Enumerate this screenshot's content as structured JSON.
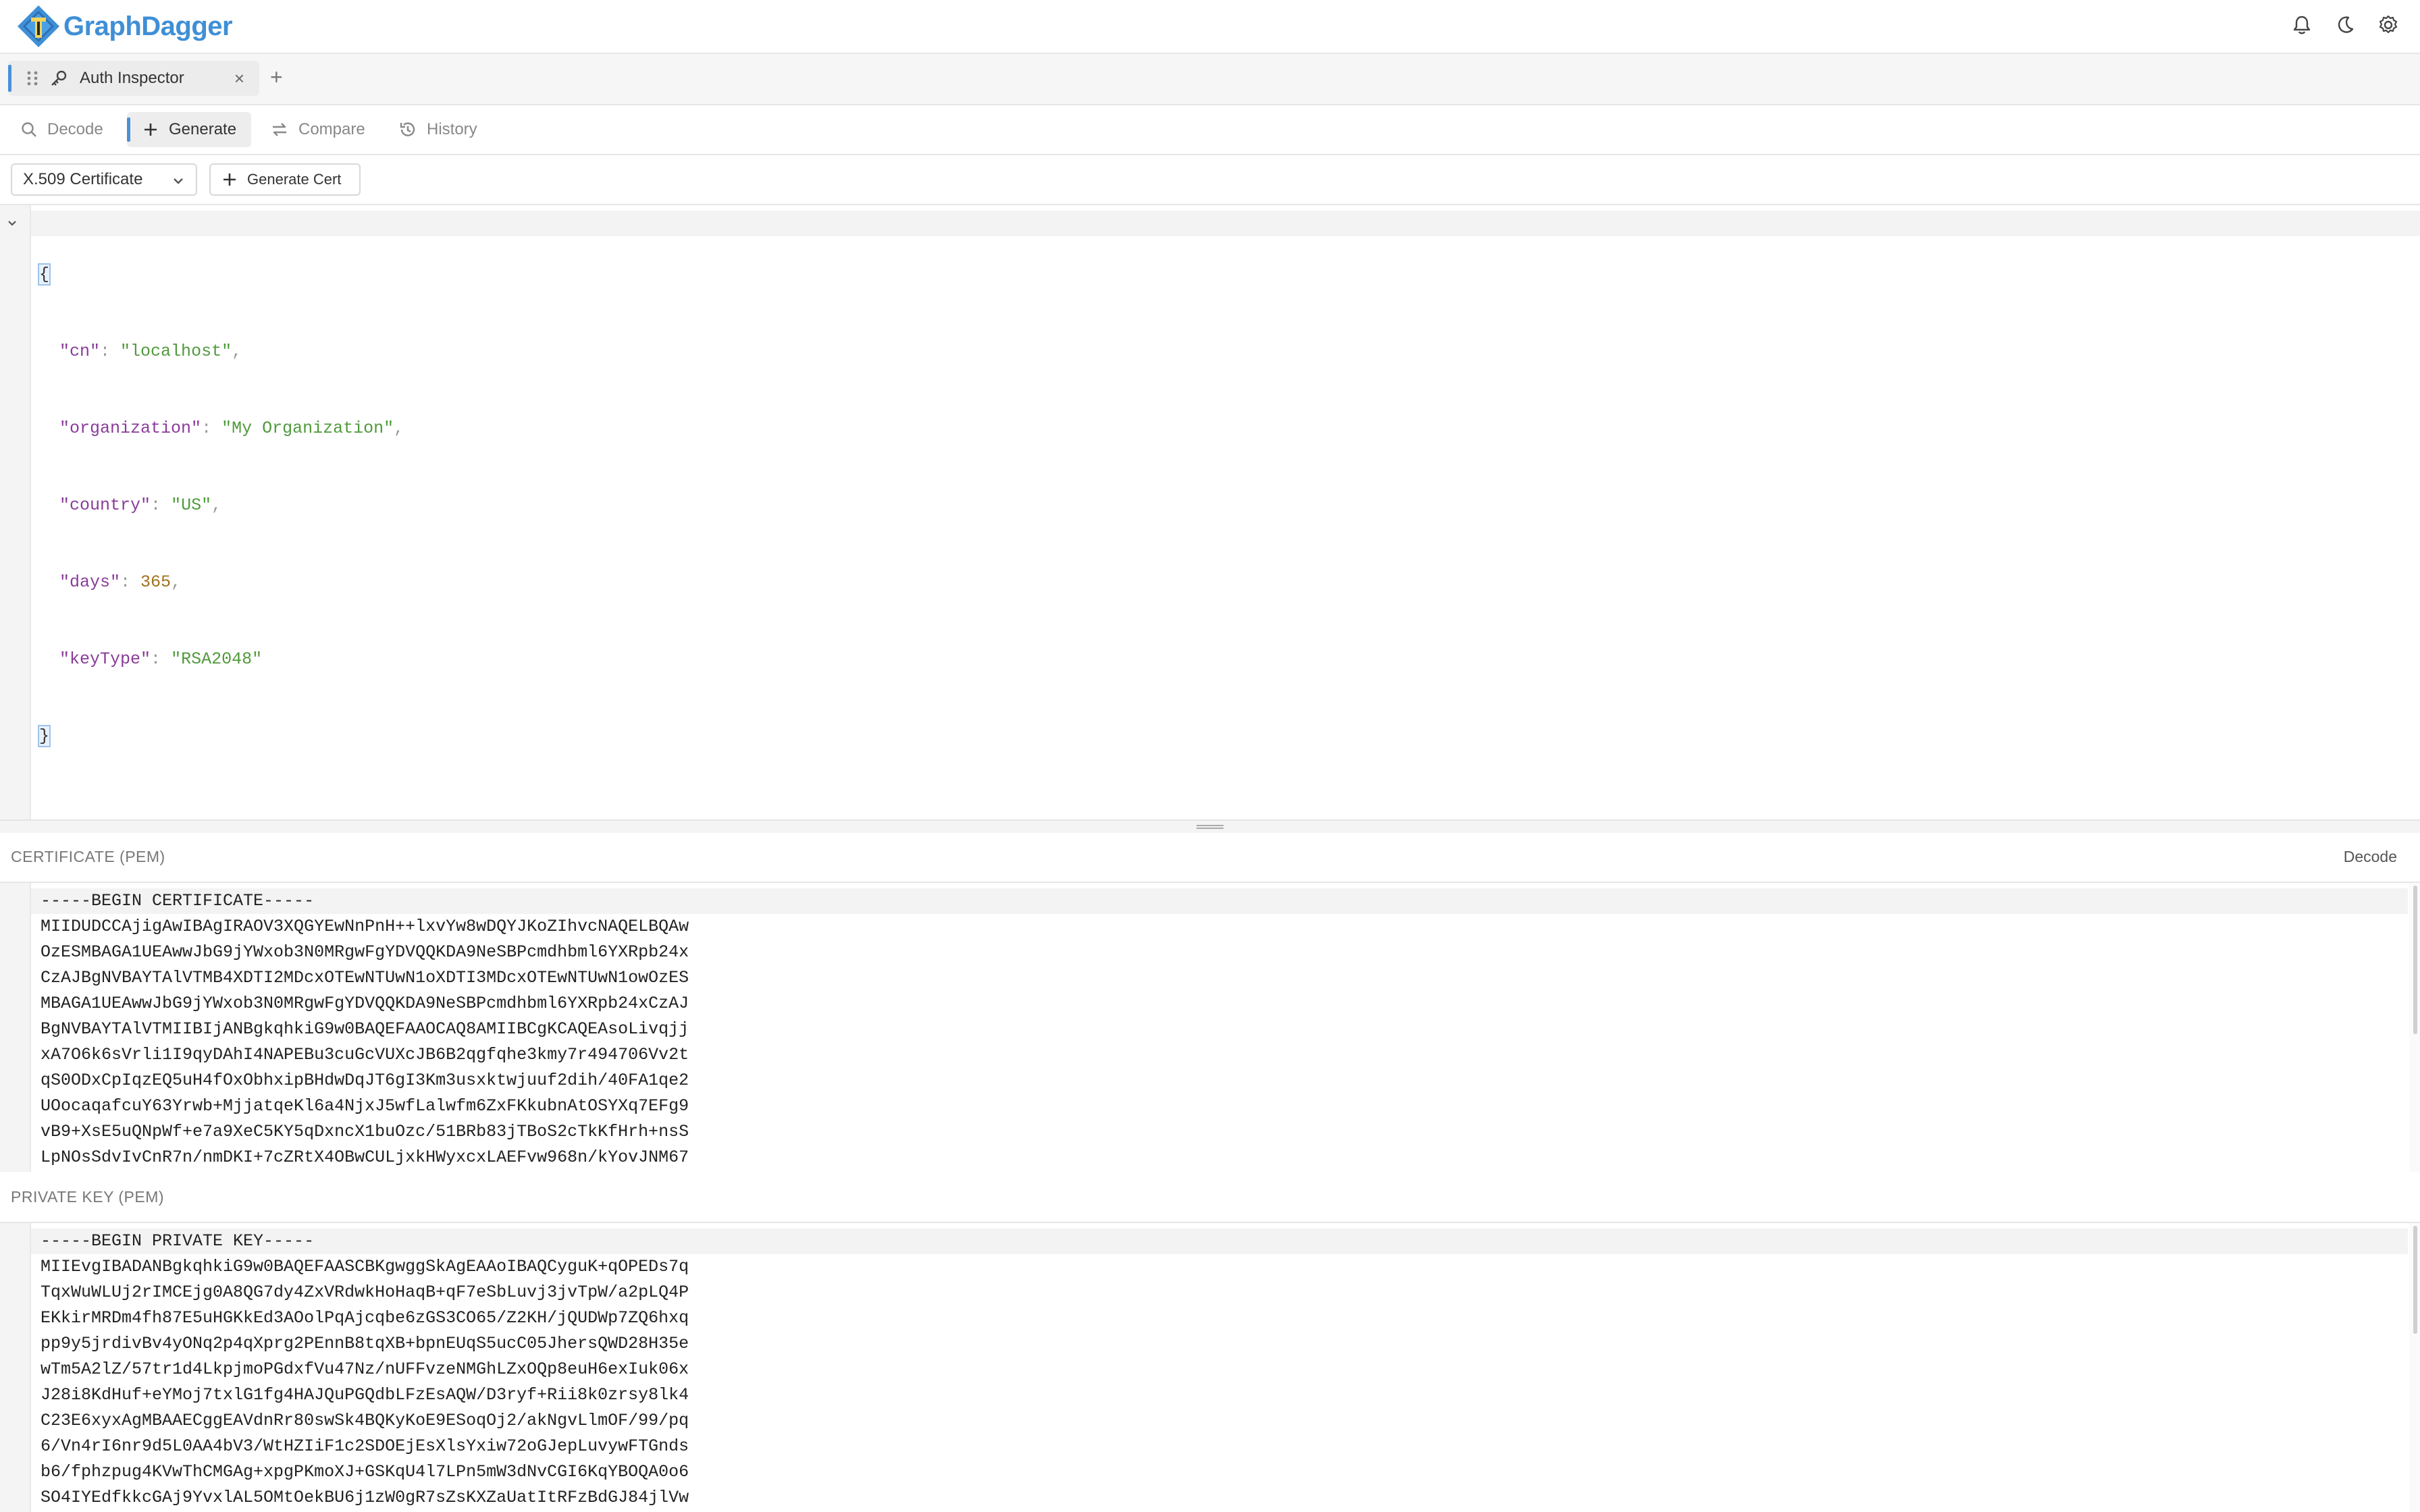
{
  "app": {
    "name": "GraphDagger"
  },
  "header": {
    "icons": [
      "bell-icon",
      "moon-icon",
      "gear-icon"
    ]
  },
  "tabs": [
    {
      "label": "Auth Inspector",
      "icon": "key-icon",
      "close": "×"
    }
  ],
  "tab_add": "+",
  "modes": [
    {
      "label": "Decode",
      "icon": "search-icon"
    },
    {
      "label": "Generate",
      "icon": "plus-icon",
      "active": true
    },
    {
      "label": "Compare",
      "icon": "swap-icon"
    },
    {
      "label": "History",
      "icon": "history-icon"
    }
  ],
  "toolbar": {
    "type_select": "X.509 Certificate",
    "generate_button": "Generate Cert"
  },
  "editor": {
    "open_brace": "{",
    "close_brace": "}",
    "fields": [
      {
        "key": "\"cn\"",
        "value": "\"localhost\"",
        "kind": "str",
        "comma": ","
      },
      {
        "key": "\"organization\"",
        "value": "\"My Organization\"",
        "kind": "str",
        "comma": ","
      },
      {
        "key": "\"country\"",
        "value": "\"US\"",
        "kind": "str",
        "comma": ","
      },
      {
        "key": "\"days\"",
        "value": "365",
        "kind": "num",
        "comma": ","
      },
      {
        "key": "\"keyType\"",
        "value": "\"RSA2048\"",
        "kind": "str",
        "comma": ""
      }
    ]
  },
  "certificate": {
    "title": "CERTIFICATE (PEM)",
    "action": "Decode",
    "lines": [
      "-----BEGIN CERTIFICATE-----",
      "MIIDUDCCAjigAwIBAgIRAOV3XQGYEwNnPnH++lxvYw8wDQYJKoZIhvcNAQELBQAw",
      "OzESMBAGA1UEAwwJbG9jYWxob3N0MRgwFgYDVQQKDA9NeSBPcmdhbml6YXRpb24x",
      "CzAJBgNVBAYTAlVTMB4XDTI2MDcxOTEwNTUwN1oXDTI3MDcxOTEwNTUwN1owOzES",
      "MBAGA1UEAwwJbG9jYWxob3N0MRgwFgYDVQQKDA9NeSBPcmdhbml6YXRpb24xCzAJ",
      "BgNVBAYTAlVTMIIBIjANBgkqhkiG9w0BAQEFAAOCAQ8AMIIBCgKCAQEAsoLivqjj",
      "xA7O6k6sVrli1I9qyDAhI4NAPEBu3cuGcVUXcJB6B2qgfqhe3kmy7r494706Vv2t",
      "qS0ODxCpIqzEQ5uH4fOxObhxipBHdwDqJT6gI3Km3usxktwjuuf2dih/40FA1qe2",
      "UOocaqafcuY63Yrwb+MjjatqeKl6a4NjxJ5wfLalwfm6ZxFKkubnAtOSYXq7EFg9",
      "vB9+XsE5uQNpWf+e7a9XeC5KY5qDxncX1buOzc/51BRb83jTBoS2cTkKfHrh+nsS",
      "LpNOsSdvIvCnR7n/nmDKI+7cZRtX4OBwCULjxkHWyxcxLAEFvw968n/kYovJNM67"
    ]
  },
  "private_key": {
    "title": "PRIVATE KEY (PEM)",
    "lines": [
      "-----BEGIN PRIVATE KEY-----",
      "MIIEvgIBADANBgkqhkiG9w0BAQEFAASCBKgwggSkAgEAAoIBAQCyguK+qOPEDs7q",
      "TqxWuWLUj2rIMCEjg0A8QG7dy4ZxVRdwkHoHaqB+qF7eSbLuvj3jvTpW/a2pLQ4P",
      "EKkirMRDm4fh87E5uHGKkEd3AOolPqAjcqbe6zGS3CO65/Z2KH/jQUDWp7ZQ6hxq",
      "pp9y5jrdivBv4yONq2p4qXprg2PEnnB8tqXB+bpnEUqS5ucC05JhersQWD28H35e",
      "wTm5A2lZ/57tr1d4LkpjmoPGdxfVu47Nz/nUFFvzeNMGhLZxOQp8euH6exIuk06x",
      "J28i8KdHuf+eYMoj7txlG1fg4HAJQuPGQdbLFzEsAQW/D3ryf+Rii8k0zrsy8lk4",
      "C23E6xyxAgMBAAECggEAVdnRr80swSk4BQKyKoE9ESoqOj2/akNgvLlmOF/99/pq",
      "6/Vn4rI6nr9d5L0AA4bV3/WtHZIiF1c2SDOEjEsXlsYxiw72oGJepLuvywFTGnds",
      "b6/fphzpug4KVwThCMGAg+xpgPKmoXJ+GSKqU4l7LPn5mW3dNvCGI6KqYBOQA0o6",
      "SO4IYEdfkkcGAj9YvxlAL5OMtOekBU6j1zW0gR7sZsKXZaUatItRFzBdGJ84jlVw"
    ]
  }
}
